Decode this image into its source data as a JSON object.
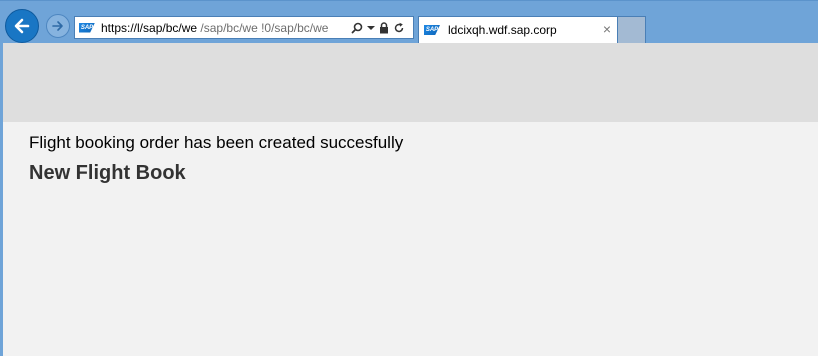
{
  "browser": {
    "address_bar": {
      "url_host": "https://l/sap/bc/we",
      "url_rest": " /sap/bc/we  !0/sap/bc/we"
    },
    "tab": {
      "title": "ldcixqh.wdf.sap.corp",
      "close_glyph": "×"
    },
    "logo_text": "SAP"
  },
  "content": {
    "message": "Flight booking order has been created succesfully",
    "page_title": "New Flight Book"
  },
  "colors": {
    "chrome": "#6fa4d8",
    "back_button": "#1976c4",
    "banner": "#dedede",
    "page_bg": "#f2f2f2"
  }
}
